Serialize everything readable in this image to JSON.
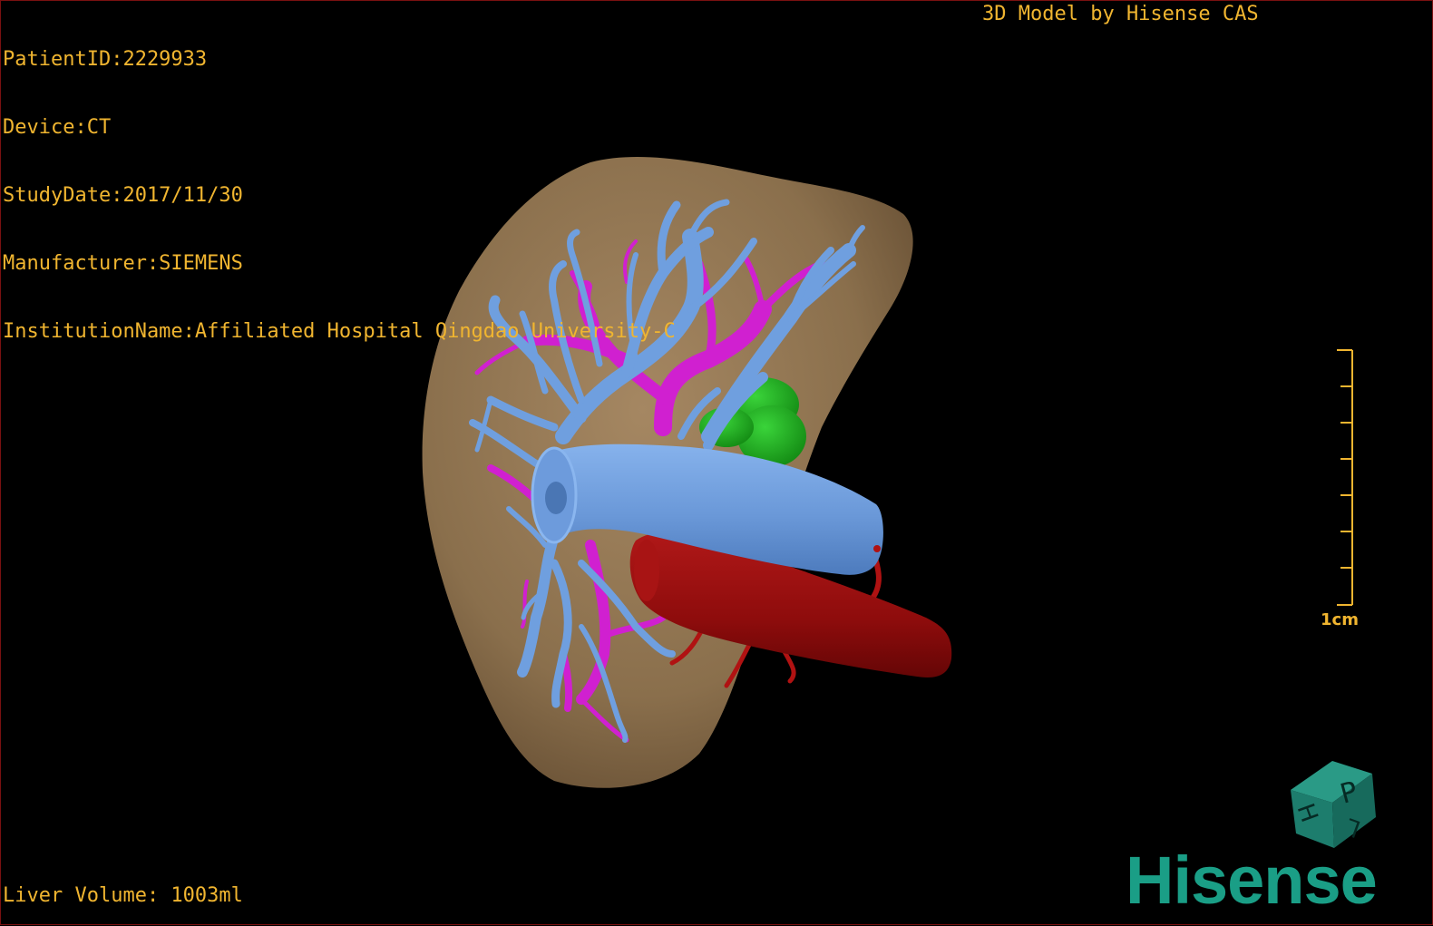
{
  "overlay": {
    "patient_id": "PatientID:2229933",
    "device": "Device:CT",
    "study_date": "StudyDate:2017/11/30",
    "manufacturer": "Manufacturer:SIEMENS",
    "institution": "InstitutionName:Affiliated Hospital Qingdao University-C",
    "credit": "3D Model by Hisense CAS",
    "liver_volume": "Liver Volume: 1003ml"
  },
  "scale_bar": {
    "label": "1cm"
  },
  "orientation_cube": {
    "faces": [
      "P",
      "H",
      "L"
    ],
    "color": "#1f7f70"
  },
  "brand": {
    "logo_text": "Hisense",
    "color": "#1a9e86"
  },
  "colors": {
    "text": "#f0b530",
    "liver": "#8f7552",
    "portal_vein": "#6f9fdf",
    "hepatic_vein": "#d020d0",
    "artery": "#9b0e0e",
    "gallbladder": "#1fa81f"
  }
}
